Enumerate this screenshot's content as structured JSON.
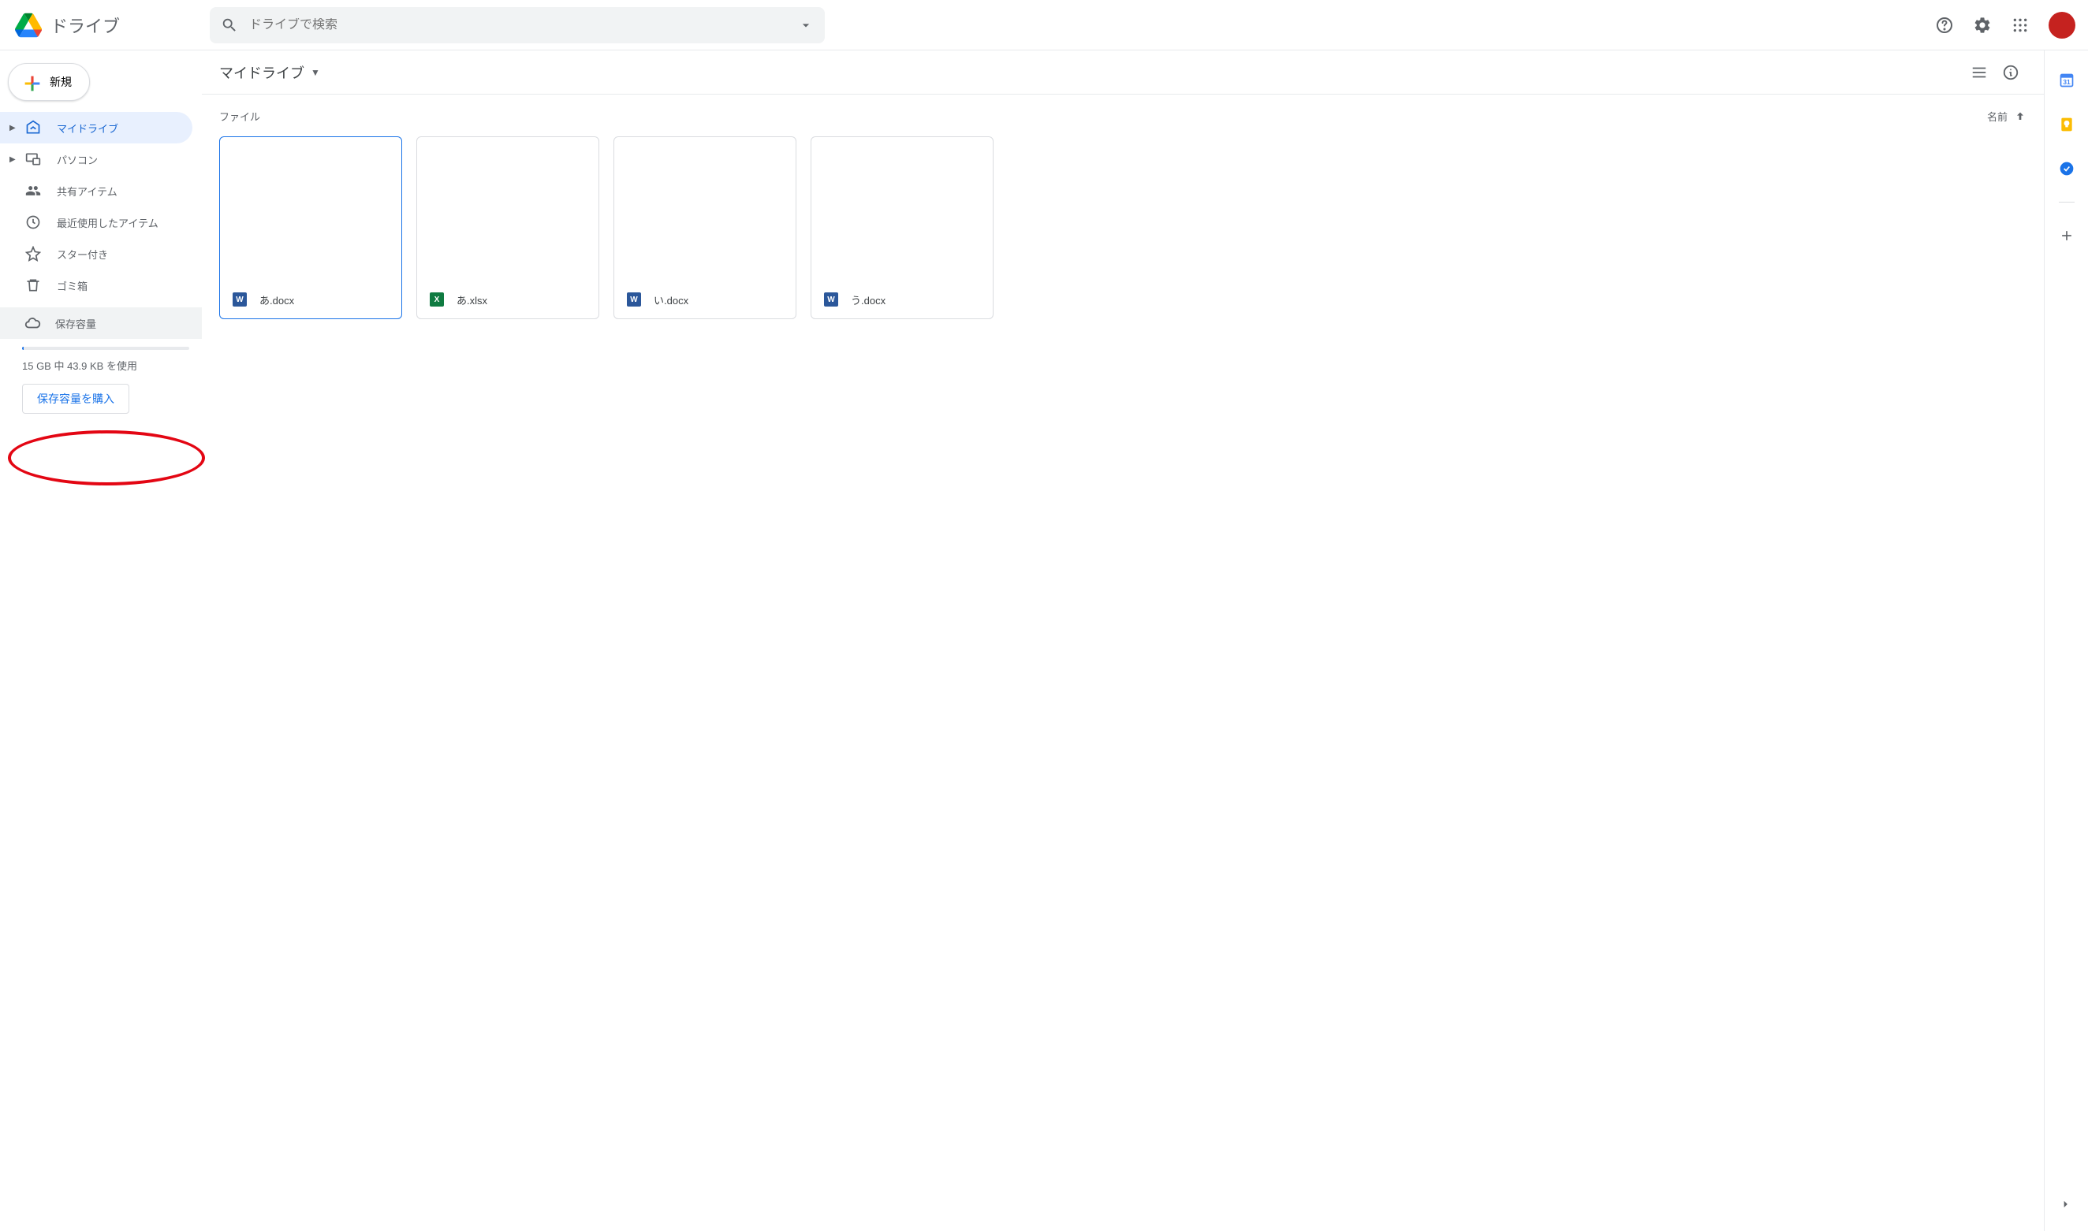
{
  "app": {
    "name": "ドライブ"
  },
  "search": {
    "placeholder": "ドライブで検索"
  },
  "newButton": {
    "label": "新規"
  },
  "sidebar": {
    "items": [
      {
        "label": "マイドライブ"
      },
      {
        "label": "パソコン"
      },
      {
        "label": "共有アイテム"
      },
      {
        "label": "最近使用したアイテム"
      },
      {
        "label": "スター付き"
      },
      {
        "label": "ゴミ箱"
      }
    ],
    "storageLabel": "保存容量",
    "storageText": "15 GB 中 43.9 KB を使用",
    "buyLabel": "保存容量を購入"
  },
  "main": {
    "breadcrumb": "マイドライブ",
    "sectionLabel": "ファイル",
    "sortLabel": "名前",
    "files": [
      {
        "name": "あ.docx",
        "type": "word"
      },
      {
        "name": "あ.xlsx",
        "type": "excel"
      },
      {
        "name": "い.docx",
        "type": "word"
      },
      {
        "name": "う.docx",
        "type": "word"
      }
    ]
  }
}
